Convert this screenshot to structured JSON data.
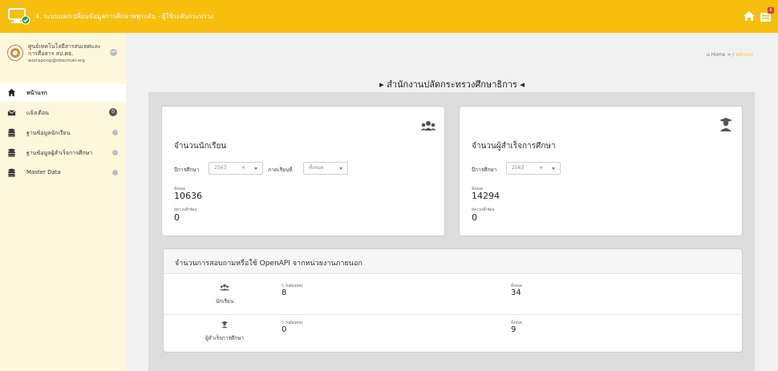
{
  "header": {
    "title": "4. ระบบแลกเปลี่ยนข้อมูลการศึกษาพหุระดับ - ผู้ใช้ระดับกระทรวง",
    "notification_count": "8"
  },
  "sidebar": {
    "org_name": "ศูนย์เทคโนโลยีสารสนเทศและการสื่อสาร สป.ศธ.",
    "org_email": "worrapong@obecmail.org",
    "items": [
      {
        "label": "หน้าแรก"
      },
      {
        "label": "แจ้งเตือน",
        "badge": "0"
      },
      {
        "label": "ฐานข้อมูลนักเรียน"
      },
      {
        "label": "ฐานข้อมูลผู้สำเร็จการศึกษา"
      },
      {
        "label": "Master Data"
      }
    ]
  },
  "breadcrumb": {
    "home": "Home",
    "separator": " > / ",
    "current": "หน้าแรก"
  },
  "page_title": "▸ สำนักงานปลัดกระทรวงศึกษาธิการ ◂",
  "students_card": {
    "title": "จำนวนนักเรียน",
    "year_label": "ปีการศึกษา",
    "year_value": "2563",
    "term_label": "ภาคเรียนที่",
    "term_value": "ทั้งหมด",
    "total_label": "ทั้งหมด",
    "total_value": "10636",
    "dup_label": "มีความซ้ำซ้อน",
    "dup_value": "0"
  },
  "graduates_card": {
    "title": "จำนวนผู้สำเร็จการศึกษา",
    "year_label": "ปีการศึกษา",
    "year_value": "2563",
    "total_label": "ทั้งหมด",
    "total_value": "14294",
    "dup_label": "มีความซ้ำซ้อน",
    "dup_value": "0"
  },
  "api_card": {
    "title": "จำนวนการสอบถามหรือใช้ OpenAPI จากหน่วยงานภายนอก",
    "rows": [
      {
        "label": "นักเรียน",
        "recent_label": "5 วันย้อนหลัง",
        "recent_value": "8",
        "total_label": "ทั้งหมด",
        "total_value": "34"
      },
      {
        "label": "ผู้สำเร็จการศึกษา",
        "recent_label": "5 วันย้อนหลัง",
        "recent_value": "0",
        "total_label": "ทั้งหมด",
        "total_value": "9"
      }
    ]
  },
  "colors": {
    "topbar": "#f7be0e",
    "sidebar": "#fdf8dc",
    "panel": "#dcdcdc"
  },
  "icons": [
    "app-logo-icon",
    "home-icon",
    "notification-icon",
    "users-icon",
    "graduate-icon",
    "envelope-icon",
    "database-icon"
  ]
}
